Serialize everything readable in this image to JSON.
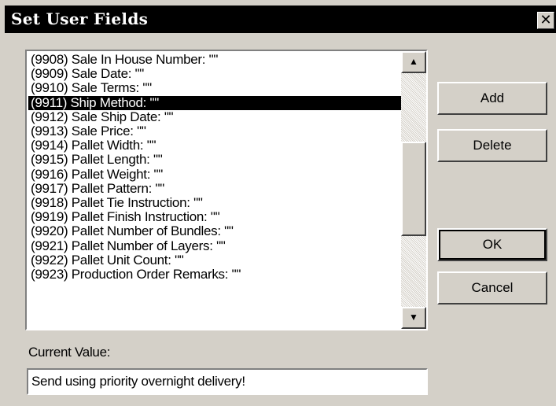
{
  "window": {
    "title": "Set User Fields",
    "close_glyph": "✕"
  },
  "list": {
    "items": [
      "(9908) Sale In House Number: \"\"",
      "(9909) Sale Date: \"\"",
      "(9910) Sale Terms: \"\"",
      "(9911) Ship Method: \"\"",
      "(9912) Sale Ship Date: \"\"",
      "(9913) Sale Price: \"\"",
      "(9914) Pallet Width: \"\"",
      "(9915) Pallet Length: \"\"",
      "(9916) Pallet Weight: \"\"",
      "(9917) Pallet Pattern: \"\"",
      "(9918) Pallet Tie Instruction: \"\"",
      "(9919) Pallet Finish Instruction: \"\"",
      "(9920) Pallet Number of Bundles: \"\"",
      "(9921) Pallet Number of Layers: \"\"",
      "(9922) Pallet Unit Count: \"\"",
      "(9923) Production Order Remarks: \"\""
    ],
    "selected_index": 3,
    "scroll_up_icon": "▲",
    "scroll_down_icon": "▼"
  },
  "buttons": {
    "add": "Add",
    "delete": "Delete",
    "ok": "OK",
    "cancel": "Cancel"
  },
  "current_value": {
    "label": "Current Value:",
    "value": "Send using priority overnight delivery!"
  },
  "colors": {
    "face": "#d4d0c8",
    "selection": "#000000",
    "titlebar": "#000000"
  }
}
